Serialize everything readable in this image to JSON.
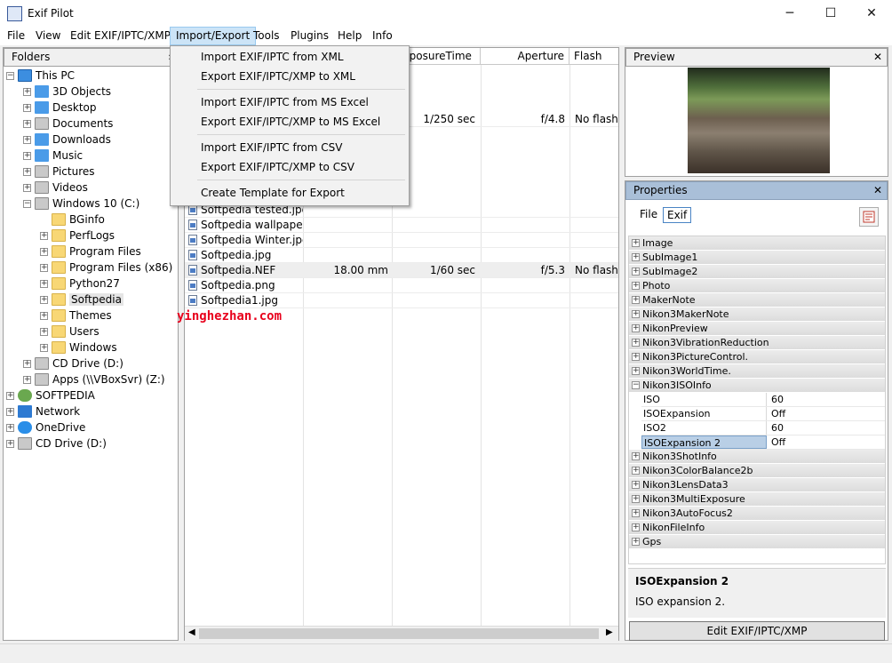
{
  "app": {
    "title": "Exif Pilot"
  },
  "window_controls": {
    "minimize": "─",
    "maximize": "☐",
    "close": "✕"
  },
  "menu": [
    "File",
    "View",
    "Edit EXIF/IPTC/XMP",
    "Import/Export",
    "Tools",
    "Plugins",
    "Help",
    "Info"
  ],
  "dropdown": {
    "items": [
      "Import EXIF/IPTC from XML",
      "Export EXIF/IPTC/XMP to XML",
      "Import EXIF/IPTC from MS Excel",
      "Export EXIF/IPTC/XMP to MS Excel",
      "Import EXIF/IPTC from CSV",
      "Export EXIF/IPTC/XMP to CSV",
      "Create Template for Export"
    ]
  },
  "folders": {
    "title": "Folders",
    "items": [
      {
        "label": "This PC",
        "icon": "pc-icon",
        "expander": "−"
      },
      {
        "label": "3D Objects",
        "icon": "folder-3d-icon",
        "expander": "+"
      },
      {
        "label": "Desktop",
        "icon": "desktop-icon",
        "expander": "+"
      },
      {
        "label": "Documents",
        "icon": "documents-icon",
        "expander": "+"
      },
      {
        "label": "Downloads",
        "icon": "downloads-icon",
        "expander": "+"
      },
      {
        "label": "Music",
        "icon": "music-icon",
        "expander": "+"
      },
      {
        "label": "Pictures",
        "icon": "pictures-icon",
        "expander": "+"
      },
      {
        "label": "Videos",
        "icon": "videos-icon",
        "expander": "+"
      },
      {
        "label": "Windows 10 (C:)",
        "icon": "drive-icon",
        "expander": "−"
      },
      {
        "label": "BGinfo",
        "icon": "folder-icon",
        "expander": ""
      },
      {
        "label": "PerfLogs",
        "icon": "folder-icon",
        "expander": "+"
      },
      {
        "label": "Program Files",
        "icon": "folder-icon",
        "expander": "+"
      },
      {
        "label": "Program Files (x86)",
        "icon": "folder-icon",
        "expander": "+"
      },
      {
        "label": "Python27",
        "icon": "folder-icon",
        "expander": "+"
      },
      {
        "label": "Softpedia",
        "icon": "folder-icon",
        "expander": "+"
      },
      {
        "label": "Themes",
        "icon": "folder-icon",
        "expander": "+"
      },
      {
        "label": "Users",
        "icon": "folder-icon",
        "expander": "+"
      },
      {
        "label": "Windows",
        "icon": "folder-icon",
        "expander": "+"
      },
      {
        "label": "CD Drive (D:)",
        "icon": "cd-drive-icon",
        "expander": "+"
      },
      {
        "label": "Apps (\\\\VBoxSvr) (Z:)",
        "icon": "network-drive-icon",
        "expander": "+"
      },
      {
        "label": "SOFTPEDIA",
        "icon": "user-icon",
        "expander": "+"
      },
      {
        "label": "Network",
        "icon": "network-icon",
        "expander": "+"
      },
      {
        "label": "OneDrive",
        "icon": "onedrive-icon",
        "expander": "+"
      },
      {
        "label": "CD Drive (D:)",
        "icon": "cd-drive-icon",
        "expander": "+"
      }
    ]
  },
  "filelist": {
    "columns": [
      "ExposureTime",
      "Aperture",
      "Flash"
    ],
    "rows": [
      {
        "name": "",
        "focal": "",
        "exposure": "1/250 sec",
        "aperture": "f/4.8",
        "flash": "No flash"
      },
      {
        "name": "Softpedia tested.jpg",
        "focal": "",
        "exposure": "",
        "aperture": "",
        "flash": ""
      },
      {
        "name": "Softpedia wallpape...",
        "focal": "",
        "exposure": "",
        "aperture": "",
        "flash": ""
      },
      {
        "name": "Softpedia Winter.jpg",
        "focal": "",
        "exposure": "",
        "aperture": "",
        "flash": ""
      },
      {
        "name": "Softpedia.jpg",
        "focal": "",
        "exposure": "",
        "aperture": "",
        "flash": ""
      },
      {
        "name": "Softpedia.NEF",
        "focal": "18.00 mm",
        "exposure": "1/60 sec",
        "aperture": "f/5.3",
        "flash": "No flash"
      },
      {
        "name": "Softpedia.png",
        "focal": "",
        "exposure": "",
        "aperture": "",
        "flash": ""
      },
      {
        "name": "Softpedia1.jpg",
        "focal": "",
        "exposure": "",
        "aperture": "",
        "flash": ""
      }
    ]
  },
  "preview": {
    "title": "Preview"
  },
  "properties": {
    "title": "Properties",
    "tabs": [
      "File",
      "Exif"
    ],
    "groups_top": [
      "Image",
      "SubImage1",
      "SubImage2",
      "Photo",
      "MakerNote",
      "Nikon3MakerNote",
      "NikonPreview",
      "Nikon3VibrationReduction",
      "Nikon3PictureControl.",
      "Nikon3WorldTime.",
      "Nikon3ISOInfo"
    ],
    "iso_values": [
      {
        "key": "ISO",
        "value": "60"
      },
      {
        "key": "ISOExpansion",
        "value": "Off"
      },
      {
        "key": "ISO2",
        "value": "60"
      },
      {
        "key": "ISOExpansion 2",
        "value": "Off"
      }
    ],
    "groups_bottom": [
      "Nikon3ShotInfo",
      "Nikon3ColorBalance2b",
      "Nikon3LensData3",
      "Nikon3MultiExposure",
      "Nikon3AutoFocus2",
      "NikonFileInfo",
      "Gps"
    ],
    "description": {
      "title": "ISOExpansion 2",
      "text": "ISO expansion 2."
    },
    "edit_button": "Edit EXIF/IPTC/XMP"
  },
  "watermark": "yinghezhan.com"
}
